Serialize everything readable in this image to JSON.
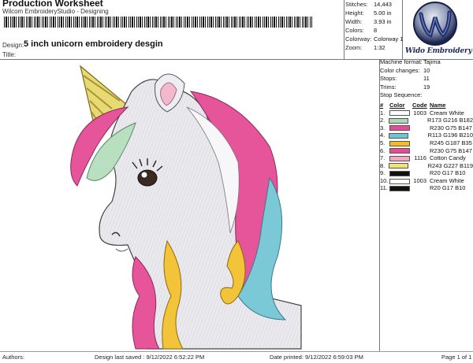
{
  "header": {
    "title": "Production Worksheet",
    "subtitle": "Wilcom EmbroideryStudio - Designing",
    "design_label": "Design:",
    "design_value": "5 inch unicorn embroidery desgin",
    "title_label": "Title:"
  },
  "stats": [
    {
      "k": "Stitches:",
      "v": "14,443"
    },
    {
      "k": "Height:",
      "v": "5.00 in"
    },
    {
      "k": "Width:",
      "v": "3.93 in"
    },
    {
      "k": "Colors:",
      "v": "8"
    },
    {
      "k": "Colorway:",
      "v": "Colorway 1"
    },
    {
      "k": "Zoom:",
      "v": "1:32"
    }
  ],
  "logo": {
    "text": "Wido Embroidery",
    "icon": "logo-emblem-icon"
  },
  "machine": [
    {
      "k": "Machine format:",
      "v": "Tajima"
    },
    {
      "k": "Color changes:",
      "v": "10"
    },
    {
      "k": "Stops:",
      "v": "11"
    },
    {
      "k": "Trims:",
      "v": "19"
    }
  ],
  "sequence": {
    "title": "Stop Sequence:",
    "headers": [
      "#",
      "Color",
      "Code",
      "Name"
    ],
    "rows": [
      {
        "n": "1.",
        "color": "#ffffff",
        "code": "1003",
        "name": "Cream White"
      },
      {
        "n": "2.",
        "color": "#add8b6",
        "code": "",
        "name": "R173 G216 B182"
      },
      {
        "n": "3.",
        "color": "#e64b93",
        "code": "",
        "name": "R230 G75 B147"
      },
      {
        "n": "4.",
        "color": "#71c4d2",
        "code": "",
        "name": "R113 G196 B210"
      },
      {
        "n": "5.",
        "color": "#f5bb23",
        "code": "",
        "name": "R245 G187 B35"
      },
      {
        "n": "6.",
        "color": "#e64b93",
        "code": "",
        "name": "R230 G75 B147"
      },
      {
        "n": "7.",
        "color": "#f4a6c4",
        "code": "1116",
        "name": "Cotton Candy"
      },
      {
        "n": "8.",
        "color": "#f3e377",
        "code": "",
        "name": "R243 G227 B119"
      },
      {
        "n": "9.",
        "color": "#14110a",
        "code": "",
        "name": "R20 G17 B10"
      },
      {
        "n": "10.",
        "color": "#ffffff",
        "code": "1003",
        "name": "Cream White"
      },
      {
        "n": "11.",
        "color": "#14110a",
        "code": "",
        "name": "R20 G17 B10"
      }
    ]
  },
  "footer": {
    "authors": "Authors:",
    "saved": "Design last saved : 9/12/2022 6:52:22 PM",
    "printed": "Date printed: 9/12/2022 6:59:03 PM",
    "page": "Page 1 of 1"
  }
}
